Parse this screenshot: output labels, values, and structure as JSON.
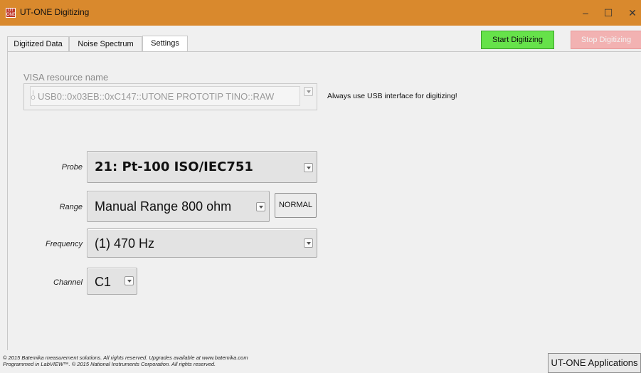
{
  "window": {
    "title": "UT-ONE Digitizing",
    "icon_text_top": "UT",
    "icon_text_bottom": "ONE",
    "controls": {
      "minimize": "–",
      "maximize": "☐",
      "close": "✕"
    },
    "titlebar_color": "#d9892d"
  },
  "tabs": [
    {
      "label": "Digitized Data",
      "active": false
    },
    {
      "label": "Noise Spectrum",
      "active": false
    },
    {
      "label": "Settings",
      "active": true
    }
  ],
  "toolbar": {
    "start_label": "Start Digitizing",
    "stop_label": "Stop Digitizing",
    "start_color": "#66e24a",
    "stop_color": "#f2b2b2"
  },
  "settings": {
    "visa_label": "VISA resource name",
    "visa_value": "USB0::0x03EB::0xC147::UTONE PROTOTIP TINO::RAW",
    "usb_note": "Always use USB interface for digitizing!",
    "probe_label": "Probe",
    "probe_value": "21: Pt-100  ISO/IEC751",
    "range_label": "Range",
    "range_value": "Manual Range   800 ohm",
    "range_mode_button": "NORMAL",
    "frequency_label": "Frequency",
    "frequency_value": "(1) 470 Hz",
    "channel_label": "Channel",
    "channel_value": "C1"
  },
  "footer": {
    "line1": "© 2015 Batemika measurement solutions. All rights reserved. Upgrades available at www.batemika.com",
    "line2": "Programmed in LabVIEW™. © 2015 National Instruments Corporation. All rights reserved.",
    "apps_button": "UT-ONE Applications"
  }
}
